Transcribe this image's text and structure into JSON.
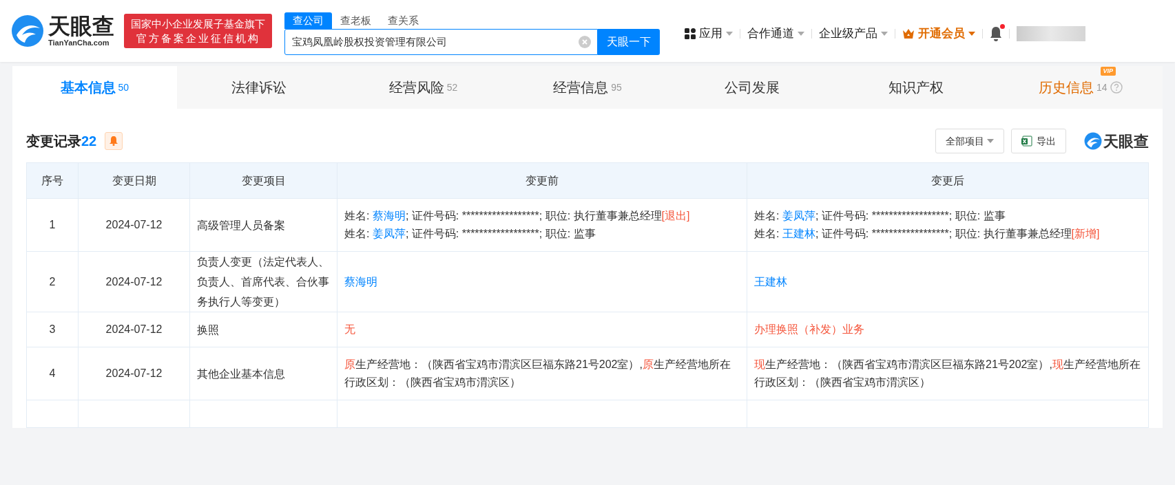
{
  "logo": {
    "name": "天眼查",
    "domain": "TianYanCha.com"
  },
  "banner": [
    "国家中小企业发展子基金旗下",
    "官方备案企业征信机构"
  ],
  "search": {
    "tabs": [
      {
        "label": "查公司",
        "selected": true
      },
      {
        "label": "查老板",
        "selected": false
      },
      {
        "label": "查关系",
        "selected": false
      }
    ],
    "value": "宝鸡凤凰岭股权投资管理有限公司",
    "button": "天眼一下"
  },
  "nav": [
    {
      "label": "应用",
      "kind": "apps"
    },
    {
      "label": "合作通道",
      "kind": "plain"
    },
    {
      "label": "企业级产品",
      "kind": "plain"
    },
    {
      "label": "开通会员",
      "kind": "vip"
    }
  ],
  "notifications": {
    "unread": true
  },
  "tabs": [
    {
      "label": "基本信息",
      "count": "50",
      "selected": true,
      "kind": "normal"
    },
    {
      "label": "法律诉讼",
      "selected": false,
      "kind": "normal"
    },
    {
      "label": "经营风险",
      "count": "52",
      "selected": false,
      "kind": "normal"
    },
    {
      "label": "经营信息",
      "count": "95",
      "selected": false,
      "kind": "normal"
    },
    {
      "label": "公司发展",
      "selected": false,
      "kind": "normal"
    },
    {
      "label": "知识产权",
      "selected": false,
      "kind": "normal"
    },
    {
      "label": "历史信息",
      "count": "14",
      "selected": false,
      "kind": "premium",
      "badge": "VIP"
    }
  ],
  "section": {
    "title": "变更记录",
    "count": "22",
    "filter": "全部项目",
    "export": "导出",
    "brand": "天眼查"
  },
  "table": {
    "columns": [
      "序号",
      "变更日期",
      "变更项目",
      "变更前",
      "变更后"
    ],
    "rows": [
      {
        "index": "1",
        "date": "2024-07-12",
        "item": "高级管理人员备案",
        "before": [
          [
            {
              "text": "姓名: ",
              "kind": "plain"
            },
            {
              "text": "蔡海明",
              "kind": "link"
            },
            {
              "text": "; 证件号码: ******************; 职位: 执行董事兼总经理",
              "kind": "plain"
            },
            {
              "text": "[退出]",
              "kind": "red"
            }
          ],
          [
            {
              "text": "姓名: ",
              "kind": "plain"
            },
            {
              "text": "姜凤萍",
              "kind": "link"
            },
            {
              "text": "; 证件号码: ******************; 职位: 监事",
              "kind": "plain"
            }
          ]
        ],
        "after": [
          [
            {
              "text": "姓名: ",
              "kind": "plain"
            },
            {
              "text": "姜凤萍",
              "kind": "link"
            },
            {
              "text": "; 证件号码: ******************; 职位: 监事",
              "kind": "plain"
            }
          ],
          [
            {
              "text": "姓名: ",
              "kind": "plain"
            },
            {
              "text": "王建林",
              "kind": "link"
            },
            {
              "text": "; 证件号码: ******************; 职位: 执行董事兼总经理",
              "kind": "plain"
            },
            {
              "text": "[新增]",
              "kind": "red"
            }
          ]
        ]
      },
      {
        "index": "2",
        "date": "2024-07-12",
        "item": "负责人变更（法定代表人、负责人、首席代表、合伙事务执行人等变更）",
        "before": [
          [
            {
              "text": "蔡海明",
              "kind": "link"
            }
          ]
        ],
        "after": [
          [
            {
              "text": "王建林",
              "kind": "link"
            }
          ]
        ]
      },
      {
        "index": "3",
        "date": "2024-07-12",
        "item": "换照",
        "before": [
          [
            {
              "text": "无",
              "kind": "red"
            }
          ]
        ],
        "after": [
          [
            {
              "text": "办理换照（补发）业务",
              "kind": "red"
            }
          ]
        ]
      },
      {
        "index": "4",
        "date": "2024-07-12",
        "item": "其他企业基本信息",
        "before": [
          [
            {
              "text": "原",
              "kind": "red"
            },
            {
              "text": "生产经营地：（陕西省宝鸡市渭滨区巨福东路21号202室）,",
              "kind": "plain"
            },
            {
              "text": "原",
              "kind": "red"
            },
            {
              "text": "生产经营地所在行政区划：（陕西省宝鸡市渭滨区）",
              "kind": "plain"
            }
          ]
        ],
        "after": [
          [
            {
              "text": "现",
              "kind": "red"
            },
            {
              "text": "生产经营地：（陕西省宝鸡市渭滨区巨福东路21号202室）,",
              "kind": "plain"
            },
            {
              "text": "现",
              "kind": "red"
            },
            {
              "text": "生产经营地所在行政区划：（陕西省宝鸡市渭滨区）",
              "kind": "plain"
            }
          ]
        ]
      }
    ]
  }
}
